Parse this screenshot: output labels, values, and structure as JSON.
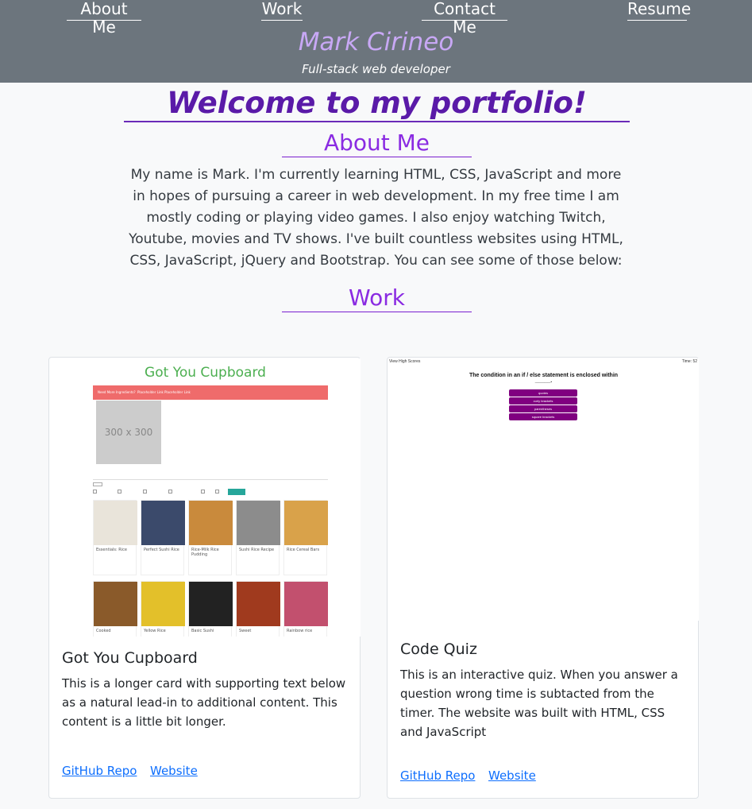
{
  "nav": {
    "about": "About Me",
    "work": "Work",
    "contact": "Contact Me",
    "resume": "Resume"
  },
  "header": {
    "name": "Mark Cirineo",
    "tagline": "Full-stack web developer"
  },
  "main": {
    "welcome": "Welcome to my portfolio!",
    "about_heading": "About Me",
    "about_text": "My name is Mark. I'm currently learning HTML, CSS, JavaScript and more in hopes of pursuing a career in web development. In my free time I am mostly coding or playing video games. I also enjoy watching Twitch, Youtube, movies and TV shows. I've built countless websites using HTML, CSS, JavaScript, jQuery and Bootstrap. You can see some of those below:",
    "work_heading": "Work"
  },
  "cards": [
    {
      "title": "Got You Cupboard",
      "text": "This is a longer card with supporting text below as a natural lead-in to additional content. This content is a little bit longer.",
      "link_repo": "GitHub Repo",
      "link_site": "Website",
      "thumb": {
        "title": "Got You Cupboard",
        "nav_items": [
          "Need More Ingredients?",
          "Placeholder Link",
          "Placeholder Link"
        ],
        "placeholder": "300 x 300",
        "foods": [
          {
            "label": "Essentials: Rice",
            "color": "#e9e4da"
          },
          {
            "label": "Perfect Sushi Rice",
            "color": "#3b4a6b"
          },
          {
            "label": "Rice-Milk Rice Pudding",
            "color": "#c98a3c"
          },
          {
            "label": "Sushi Rice Recipe",
            "color": "#8c8c8c"
          },
          {
            "label": "Rice Cereal Bars",
            "color": "#d9a24a"
          },
          {
            "label": "Cooked",
            "color": "#8a5a2a"
          },
          {
            "label": "Yellow Rice",
            "color": "#e3c02a"
          },
          {
            "label": "Basic Sushi",
            "color": "#222222"
          },
          {
            "label": "Sweet",
            "color": "#a03a1e"
          },
          {
            "label": "Rainbow rice",
            "color": "#c2506e"
          }
        ]
      }
    },
    {
      "title": "Code Quiz",
      "text": "This is an interactive quiz. When you answer a question wrong time is subtacted from the timer. The website was built with HTML, CSS and JavaScript",
      "link_repo": "GitHub Repo",
      "link_site": "Website",
      "thumb": {
        "high_scores": "View High Scores",
        "time": "Time: 52",
        "question": "The condition in an if / else statement is enclosed within _____.",
        "answers": [
          "quotes",
          "curly brackets",
          "parentheses",
          "square brackets"
        ]
      }
    }
  ],
  "colors": {
    "header_bg": "#6c757d",
    "name": "#c8a8f5",
    "welcome": "#5a1aa8",
    "section_heading": "#8a2be2",
    "link": "#0d6efd",
    "quiz_button": "#800080"
  }
}
